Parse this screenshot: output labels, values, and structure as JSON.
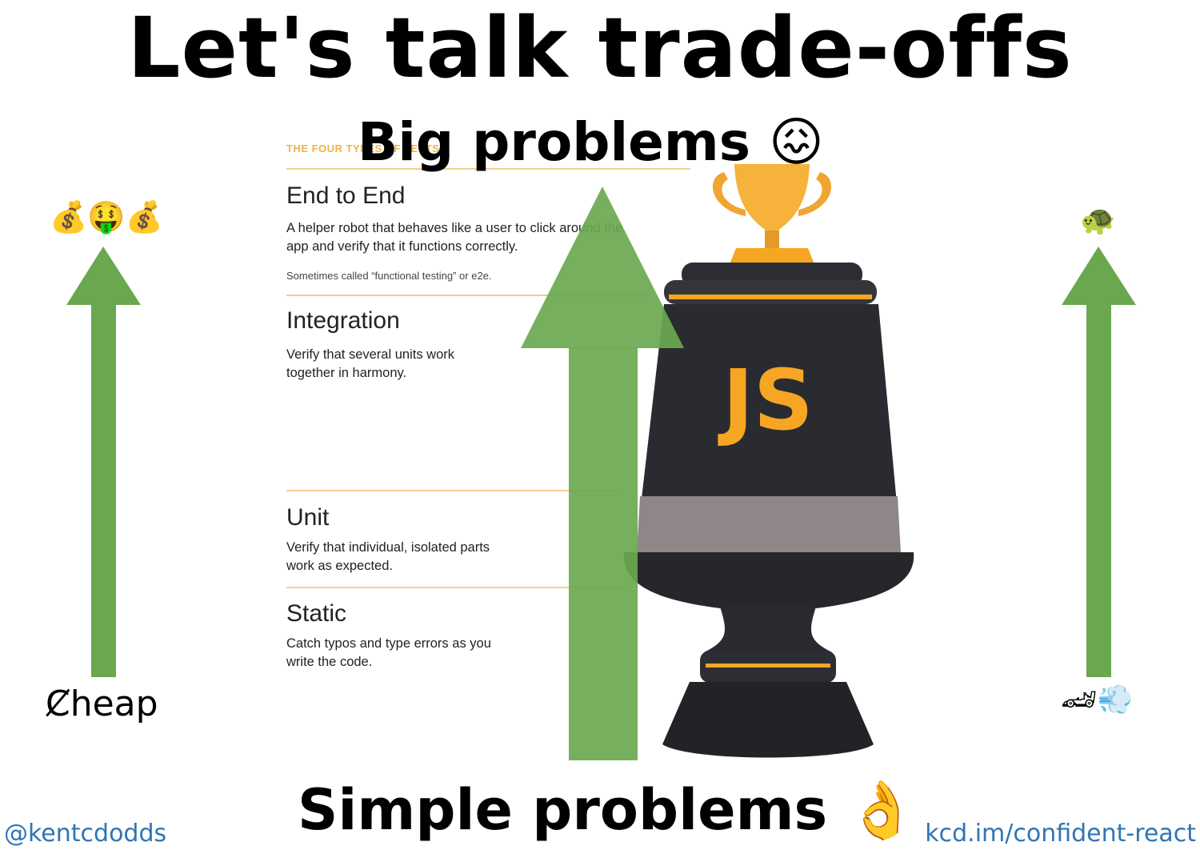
{
  "slide": {
    "title": "Let's talk trade-offs",
    "top_label": "Big problems",
    "top_emoji": "😖",
    "bottom_label": "Simple problems",
    "bottom_emoji": "👌"
  },
  "left_axis": {
    "top_icons": "💰🤑💰",
    "bottom_label": "Ȼheap"
  },
  "right_axis": {
    "top_icon": "🐢",
    "bottom_icons": "🏎💨"
  },
  "card": {
    "kicker": "THE FOUR TYPES OF TESTS",
    "sections": [
      {
        "heading": "End to End",
        "body": "A helper robot that behaves like a user to click around the app and verify that it functions correctly.",
        "note": "Sometimes called “functional testing” or e2e."
      },
      {
        "heading": "Integration",
        "body": "Verify that several units work together in harmony."
      },
      {
        "heading": "Unit",
        "body": "Verify that individual, isolated parts work as expected."
      },
      {
        "heading": "Static",
        "body": "Catch typos and type errors as you write the code."
      }
    ]
  },
  "trophy": {
    "label": "JS"
  },
  "footer": {
    "left": "@kentcdodds",
    "right": "kcd.im/confident-react"
  },
  "colors": {
    "arrow": "#6aa84f",
    "accent": "#f6a623",
    "trophy_body": "#2a2b30",
    "trophy_band": "#8f8787",
    "link": "#2f75b5"
  }
}
